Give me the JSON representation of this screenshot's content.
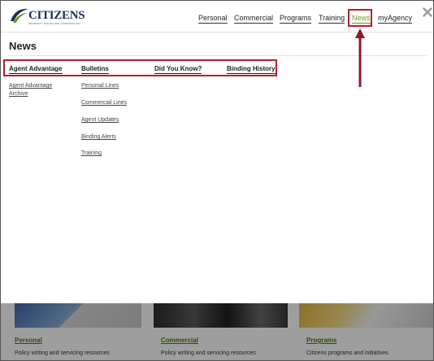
{
  "brand": {
    "name": "CITIZENS",
    "tagline": "PROPERTY INSURANCE CORPORATION",
    "colors": {
      "navy": "#1b2f50",
      "accent_green": "#6a9a1f",
      "highlight_red": "#b5202e"
    }
  },
  "topnav": {
    "items": [
      {
        "label": "Personal"
      },
      {
        "label": "Commercial"
      },
      {
        "label": "Programs"
      },
      {
        "label": "Training"
      },
      {
        "label": "News",
        "active": true
      },
      {
        "label": "myAgency"
      }
    ],
    "close_icon": "close-icon"
  },
  "menu": {
    "title": "News",
    "columns": [
      {
        "heading": "Agent Advantage",
        "links": [
          "Agent Advantage Archive"
        ]
      },
      {
        "heading": "Bulletins",
        "links": [
          "Personal Lines",
          "Commercial Lines",
          "Agent Updates",
          "Binding Alerts",
          "Training"
        ]
      },
      {
        "heading": "Did You Know?",
        "links": []
      },
      {
        "heading": "Binding History",
        "links": []
      }
    ]
  },
  "cards": [
    {
      "title": "Personal",
      "description": "Policy writing and servicing resources"
    },
    {
      "title": "Commercial",
      "description": "Policy writing and servicing resources"
    },
    {
      "title": "Programs",
      "description": "Citizens programs and initiatives"
    }
  ]
}
